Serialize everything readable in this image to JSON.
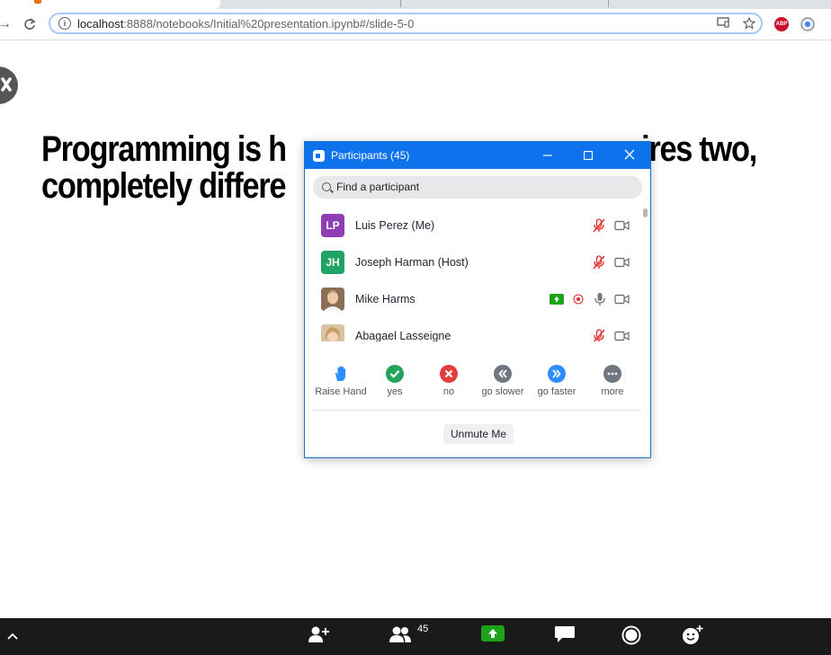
{
  "browser": {
    "url_host": "localhost",
    "url_path": ":8888/notebooks/Initial%20presentation.ipynb#/slide-5-0",
    "abp_label": "ABP"
  },
  "slide": {
    "heading_line1": "Programming is h",
    "heading_line1_end": "equires two,",
    "heading_line2": "completely differe"
  },
  "participants_panel": {
    "title": "Participants (45)",
    "search_placeholder": "Find a participant",
    "participants": [
      {
        "name": "Luis Perez (Me)",
        "initials": "LP",
        "avatar_color": "#8e3fb3"
      },
      {
        "name": "Joseph Harman (Host)",
        "initials": "JH",
        "avatar_color": "#21a366"
      },
      {
        "name": "Mike Harms",
        "initials": "",
        "avatar_color": "#a68b6d"
      },
      {
        "name": "Abagael Lasseigne",
        "initials": "",
        "avatar_color": "#c9a883"
      }
    ],
    "reactions": [
      {
        "label": "Raise Hand",
        "icon": "raise-hand-icon"
      },
      {
        "label": "yes",
        "icon": "check-icon"
      },
      {
        "label": "no",
        "icon": "x-icon"
      },
      {
        "label": "go slower",
        "icon": "rewind-icon"
      },
      {
        "label": "go faster",
        "icon": "fast-forward-icon"
      },
      {
        "label": "more",
        "icon": "more-icon"
      }
    ],
    "unmute_label": "Unmute Me"
  },
  "zoom_toolbar": {
    "participant_count": "45"
  },
  "colors": {
    "zoom_blue": "#0e72ed",
    "muted_red": "#e02828",
    "share_green": "#1da319"
  }
}
